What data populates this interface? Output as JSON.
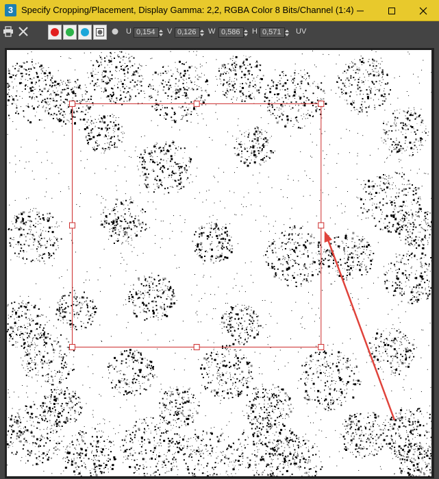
{
  "window": {
    "app_icon_label": "3",
    "title": "Specify Cropping/Placement, Display Gamma: 2,2, RGBA Color 8 Bits/Channel (1:4)",
    "minimize_icon": "minimize-icon",
    "maximize_icon": "maximize-icon",
    "close_icon": "close-icon"
  },
  "toolbar": {
    "print_icon": "printer-icon",
    "clear_icon": "x-icon",
    "channels": [
      {
        "name": "red",
        "color": "#e22020"
      },
      {
        "name": "green",
        "color": "#2db34a"
      },
      {
        "name": "blue",
        "color": "#1aa6d9"
      },
      {
        "name": "alpha",
        "color": "#777777"
      }
    ],
    "mono_icon": "circle-icon",
    "u_label": "U",
    "u_value": "0,154",
    "v_label": "V",
    "v_value": "0,126",
    "w_label": "W",
    "w_value": "0,586",
    "h_label": "H",
    "h_value": "0,571",
    "uv_label": "UV"
  },
  "crop": {
    "border_color": "#cc2a2a",
    "arrow_color": "#e0433b"
  }
}
